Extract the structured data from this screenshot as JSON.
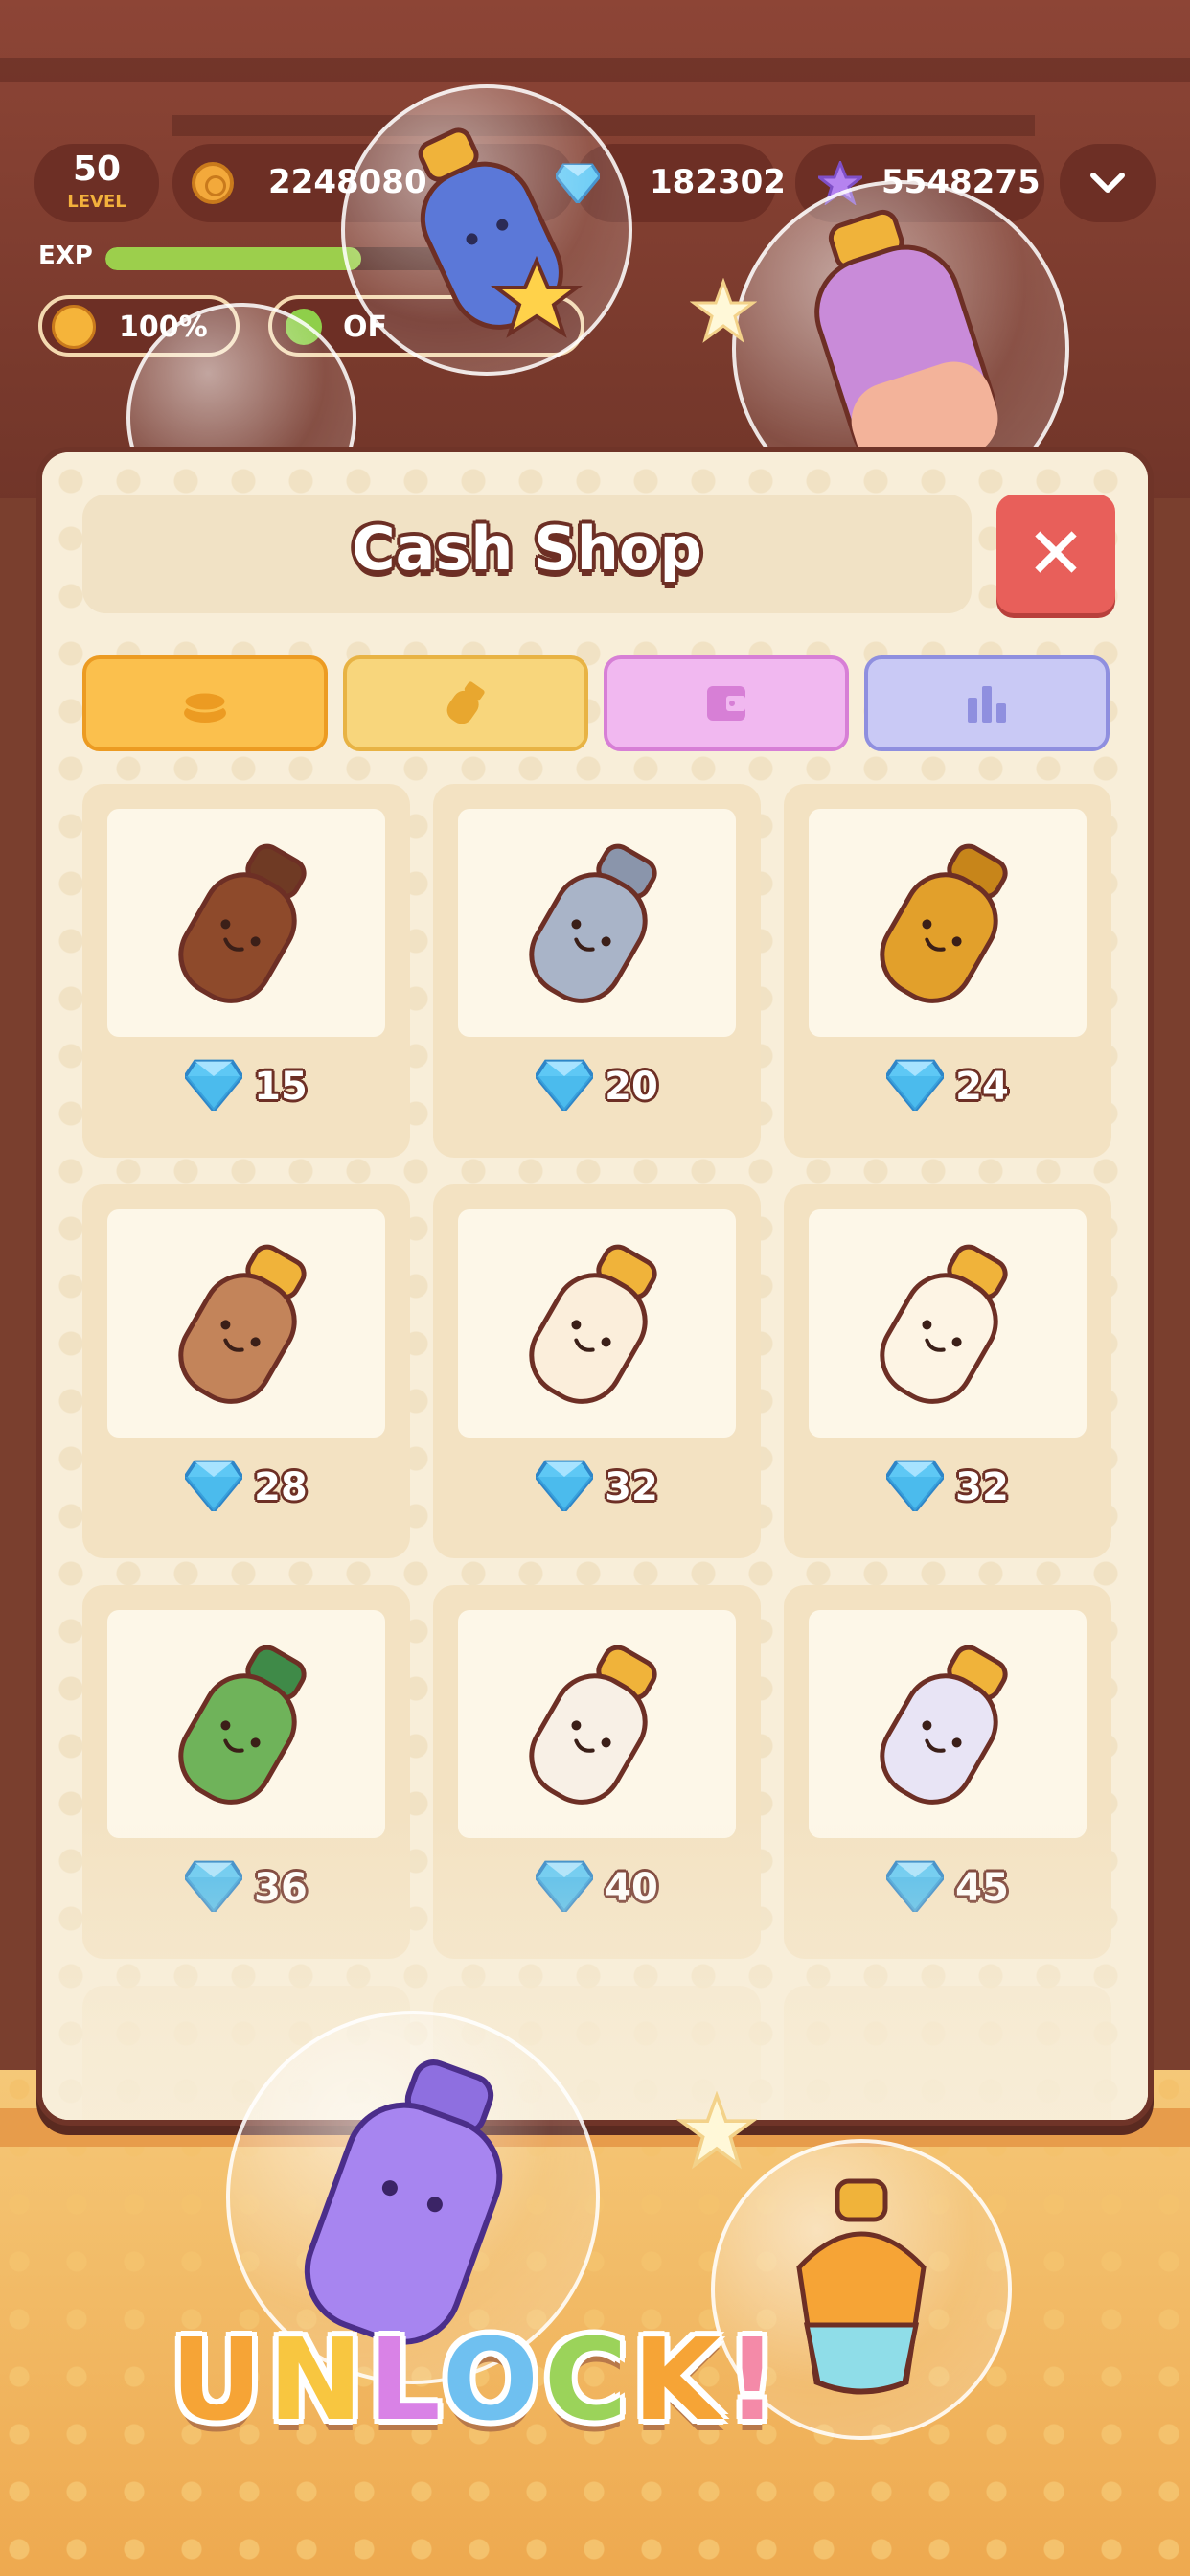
{
  "hud": {
    "level_value": "50",
    "level_label": "LEVEL",
    "coins": "2248080",
    "gems": "182302",
    "stars": "5548275",
    "exp_label": "EXP",
    "exp_progress": 0.62,
    "happiness": "100%",
    "status": "OF"
  },
  "shop": {
    "title": "Cash Shop",
    "close_icon": "✕",
    "tabs": [
      {
        "icon": "coin-stack-icon",
        "color": "#fbc04d"
      },
      {
        "icon": "shaker-icon",
        "color": "#f8d67c"
      },
      {
        "icon": "wallet-icon",
        "color": "#f1b8f0"
      },
      {
        "icon": "bar-chart-icon",
        "color": "#c9c9f5"
      }
    ],
    "items": [
      {
        "name": "brown-shaker",
        "price": "15",
        "body": "#8e4a2b",
        "cap": "#6f3a24"
      },
      {
        "name": "silver-shaker",
        "price": "20",
        "body": "#a9b4c8",
        "cap": "#8a95ab"
      },
      {
        "name": "gold-shaker",
        "price": "24",
        "body": "#e2a02b",
        "cap": "#c7851a"
      },
      {
        "name": "boba-bottle",
        "price": "28",
        "body": "#c3845a",
        "cap": "#f0b33a"
      },
      {
        "name": "cat-bottle",
        "price": "32",
        "body": "#fbeedb",
        "cap": "#f0b33a"
      },
      {
        "name": "panda-bottle",
        "price": "32",
        "body": "#fdf4e4",
        "cap": "#f0b33a"
      },
      {
        "name": "frog-bottle",
        "price": "36",
        "body": "#6fb35a",
        "cap": "#3f8a48"
      },
      {
        "name": "duck-bottle",
        "price": "40",
        "body": "#f8f0e6",
        "cap": "#f0b33a"
      },
      {
        "name": "ghost-bottle",
        "price": "45",
        "body": "#e8e4f5",
        "cap": "#f0b33a"
      }
    ]
  },
  "banner": {
    "letters": [
      {
        "ch": "U",
        "color": "#f6a436"
      },
      {
        "ch": "N",
        "color": "#f8c640"
      },
      {
        "ch": "L",
        "color": "#d982e6"
      },
      {
        "ch": "O",
        "color": "#6fc0f0"
      },
      {
        "ch": "C",
        "color": "#9bd35a"
      },
      {
        "ch": "K",
        "color": "#f6a436"
      },
      {
        "ch": "!",
        "color": "#f48aa8"
      }
    ]
  },
  "colors": {
    "gem": "#5ec8f5",
    "outline": "#6d2f25"
  }
}
